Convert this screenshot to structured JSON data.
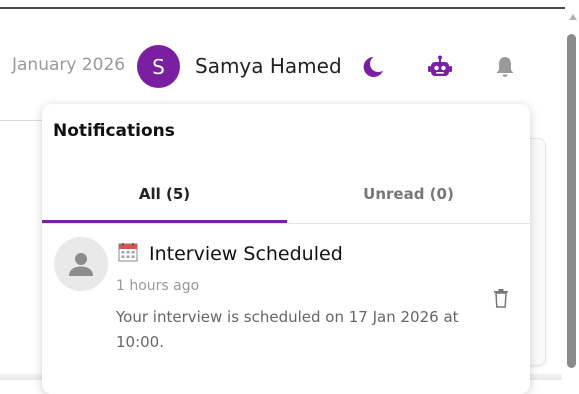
{
  "header": {
    "date": "January 2026",
    "user_initial": "S",
    "user_name": "Samya Hamed",
    "icons": [
      "moon-icon",
      "robot-icon",
      "bell-icon"
    ]
  },
  "notifications_panel": {
    "title": "Notifications",
    "tabs": [
      {
        "label": "All (5)",
        "active": true
      },
      {
        "label": "Unread (0)",
        "active": false
      }
    ],
    "items": [
      {
        "icon": "calendar-icon",
        "title": "Interview Scheduled",
        "time": "1 hours ago",
        "body": "Your interview is scheduled on 17 Jan 2026 at 10:00."
      }
    ]
  },
  "colors": {
    "accent": "#7b1fa2"
  }
}
